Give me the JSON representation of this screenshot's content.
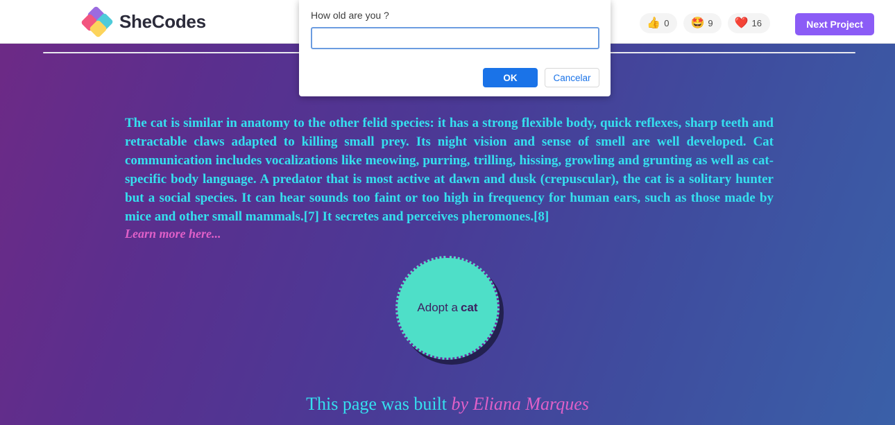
{
  "header": {
    "logo": {
      "text": "SheCodes",
      "icon": "shecodes-logo-icon",
      "colors": {
        "purple": "#9b6bdf",
        "pink": "#f2557f",
        "teal": "#4ecbd9",
        "yellow": "#fcd45c"
      }
    },
    "reactions": [
      {
        "icon": "thumbs-up-icon",
        "emoji": "👍",
        "count": "0"
      },
      {
        "icon": "star-struck-face-icon",
        "emoji": "🤩",
        "count": "9"
      },
      {
        "icon": "heart-icon",
        "emoji": "❤️",
        "count": "16"
      }
    ],
    "next_project_label": "Next Project",
    "next_project_color": "#8b5cf6"
  },
  "main": {
    "article_text": "The cat is similar in anatomy to the other felid species: it has a strong flexible body, quick reflexes, sharp teeth and retractable claws adapted to killing small prey. Its night vision and sense of smell are well developed. Cat communication includes vocalizations like meowing, purring, trilling, hissing, growling and grunting as well as cat-specific body language. A predator that is most active at dawn and dusk (crepuscular), the cat is a solitary hunter but a social species. It can hear sounds too faint or too high in frequency for human ears, such as those made by mice and other small mammals.[7] It secretes and perceives pheromones.[8]",
    "learn_more_label": "Learn more here...",
    "adopt_button": {
      "prefix": "Adopt a",
      "highlight": "cat",
      "fill_color": "#4edfc8",
      "border_color": "#6a2a9c"
    },
    "footer_prefix": "This page was built",
    "footer_author": "by Eliana Marques",
    "text_color": "#35e0ef",
    "accent_color": "#e060c8"
  },
  "dialog": {
    "message": "How old are you ?",
    "input_value": "",
    "input_placeholder": "",
    "ok_label": "OK",
    "cancel_label": "Cancelar",
    "ok_color": "#1a73e8"
  }
}
